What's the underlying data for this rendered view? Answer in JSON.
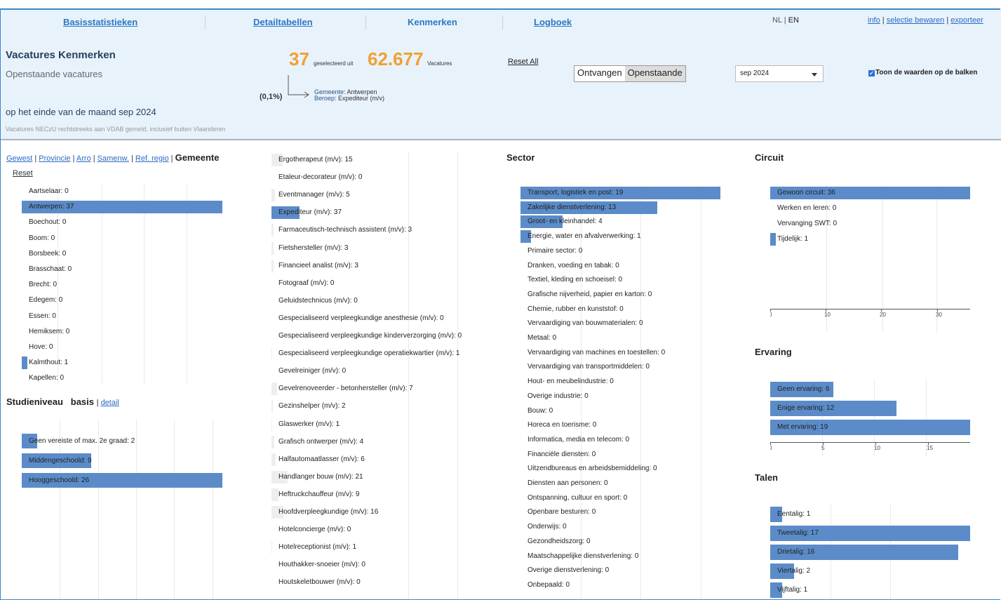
{
  "nav": {
    "items": [
      {
        "label": "Basisstatistieken"
      },
      {
        "label": "Detailtabellen"
      },
      {
        "label": "Kenmerken"
      },
      {
        "label": "Logboek"
      }
    ],
    "lang_nl": "NL",
    "lang_sep": " | ",
    "lang_en": "EN",
    "info": "info",
    "bewaren": "selectie bewaren",
    "export": "exporteer",
    "sep": " | "
  },
  "header": {
    "title": "Vacatures Kenmerken",
    "subtitle": "Openstaande vacatures",
    "period": "op het einde van de maand sep 2024",
    "note": "Vacatures NECzU rechtstreeks aan VDAB gemeld, inclusief buiten Vlaanderen",
    "selected": "37",
    "selected_label": "geselecteerd uit",
    "total": "62.677",
    "total_label": "Vacatures",
    "pct": "(0,1%)",
    "filter1_key": "Gemeente",
    "filter1_val": ": Antwerpen",
    "filter2_key": "Beroep",
    "filter2_val": ": Expediteur (m/v)",
    "reset_all": "Reset All",
    "toggle": [
      "Ontvangen",
      "Openstaande"
    ],
    "month": "sep 2024",
    "show_values": "Toon de waarden op de balken"
  },
  "geo": {
    "tabs": [
      "Gewest",
      "Provincie",
      "Arro",
      "Samenw.",
      "Ref. regio"
    ],
    "active": "Gemeente",
    "tab_sep": " | ",
    "reset": "Reset",
    "max": 37,
    "rows": [
      {
        "label": "Aartselaar: 0",
        "value": 0
      },
      {
        "label": "Antwerpen: 37",
        "value": 37
      },
      {
        "label": "Boechout: 0",
        "value": 0
      },
      {
        "label": "Boom: 0",
        "value": 0
      },
      {
        "label": "Borsbeek: 0",
        "value": 0
      },
      {
        "label": "Brasschaat: 0",
        "value": 0
      },
      {
        "label": "Brecht: 0",
        "value": 0
      },
      {
        "label": "Edegem: 0",
        "value": 0
      },
      {
        "label": "Essen: 0",
        "value": 0
      },
      {
        "label": "Hemiksem: 0",
        "value": 0
      },
      {
        "label": "Hove: 0",
        "value": 0
      },
      {
        "label": "Kalmthout: 1",
        "value": 1
      },
      {
        "label": "Kapellen: 0",
        "value": 0
      }
    ]
  },
  "studie": {
    "title": "Studieniveau",
    "basis": "basis",
    "sep": " | ",
    "detail": "detail",
    "max": 26,
    "rows": [
      {
        "label": "Geen vereiste of max. 2e graad: 2",
        "value": 2
      },
      {
        "label": "Middengeschoold: 9",
        "value": 9
      },
      {
        "label": "Hooggeschoold: 26",
        "value": 26
      }
    ]
  },
  "beroep": {
    "max": 37,
    "rows": [
      {
        "label": "Ergotherapeut (m/v): 15",
        "value": 15
      },
      {
        "label": "Etaleur-decorateur (m/v): 0",
        "value": 0
      },
      {
        "label": "Eventmanager (m/v): 5",
        "value": 5
      },
      {
        "label": "Expediteur (m/v): 37",
        "value": 37,
        "sel": true
      },
      {
        "label": "Farmaceutisch-technisch assistent (m/v): 3",
        "value": 3
      },
      {
        "label": "Fietshersteller (m/v): 3",
        "value": 3
      },
      {
        "label": "Financieel analist (m/v): 3",
        "value": 3
      },
      {
        "label": "Fotograaf (m/v): 0",
        "value": 0
      },
      {
        "label": "Geluidstechnicus (m/v): 0",
        "value": 0
      },
      {
        "label": "Gespecialiseerd verpleegkundige anesthesie (m/v): 0",
        "value": 0
      },
      {
        "label": "Gespecialiseerd verpleegkundige kinderverzorging (m/v): 0",
        "value": 0
      },
      {
        "label": "Gespecialiseerd verpleegkundige operatiekwartier (m/v): 1",
        "value": 1
      },
      {
        "label": "Gevelreiniger (m/v): 0",
        "value": 0
      },
      {
        "label": "Gevelrenoveerder - betonhersteller (m/v): 7",
        "value": 7
      },
      {
        "label": "Gezinshelper (m/v): 2",
        "value": 2
      },
      {
        "label": "Glaswerker (m/v): 1",
        "value": 1
      },
      {
        "label": "Grafisch ontwerper (m/v): 4",
        "value": 4
      },
      {
        "label": "Halfautomaatlasser (m/v): 6",
        "value": 6
      },
      {
        "label": "Handlanger bouw (m/v): 21",
        "value": 21
      },
      {
        "label": "Heftruckchauffeur (m/v): 9",
        "value": 9
      },
      {
        "label": "Hoofdverpleegkundige (m/v): 16",
        "value": 16
      },
      {
        "label": "Hotelconcierge (m/v): 0",
        "value": 0
      },
      {
        "label": "Hotelreceptionist (m/v): 1",
        "value": 1
      },
      {
        "label": "Houthakker-snoeier (m/v): 0",
        "value": 0
      },
      {
        "label": "Houtskeletbouwer (m/v): 0",
        "value": 0
      }
    ]
  },
  "sector": {
    "title": "Sector",
    "max": 19,
    "rows": [
      {
        "label": "Transport, logistiek en post: 19",
        "value": 19
      },
      {
        "label": "Zakelijke dienstverlening: 13",
        "value": 13
      },
      {
        "label": "Groot- en kleinhandel: 4",
        "value": 4
      },
      {
        "label": "Energie, water en afvalverwerking: 1",
        "value": 1
      },
      {
        "label": "Primaire sector: 0",
        "value": 0
      },
      {
        "label": "Dranken, voeding en tabak: 0",
        "value": 0
      },
      {
        "label": "Textiel, kleding en schoeisel: 0",
        "value": 0
      },
      {
        "label": "Grafische nijverheid, papier en karton: 0",
        "value": 0
      },
      {
        "label": "Chemie, rubber en kunststof: 0",
        "value": 0
      },
      {
        "label": "Vervaardiging van bouwmaterialen: 0",
        "value": 0
      },
      {
        "label": "Metaal: 0",
        "value": 0
      },
      {
        "label": "Vervaardiging van machines en toestellen: 0",
        "value": 0
      },
      {
        "label": "Vervaardiging van transportmiddelen: 0",
        "value": 0
      },
      {
        "label": "Hout- en meubelindustrie: 0",
        "value": 0
      },
      {
        "label": "Overige industrie: 0",
        "value": 0
      },
      {
        "label": "Bouw: 0",
        "value": 0
      },
      {
        "label": "Horeca en toerisme: 0",
        "value": 0
      },
      {
        "label": "Informatica, media en telecom: 0",
        "value": 0
      },
      {
        "label": "Financiële diensten: 0",
        "value": 0
      },
      {
        "label": "Uitzendbureaus en arbeidsbemiddeling: 0",
        "value": 0
      },
      {
        "label": "Diensten aan personen: 0",
        "value": 0
      },
      {
        "label": "Ontspanning, cultuur en sport: 0",
        "value": 0
      },
      {
        "label": "Openbare besturen: 0",
        "value": 0
      },
      {
        "label": "Onderwijs: 0",
        "value": 0
      },
      {
        "label": "Gezondheidszorg: 0",
        "value": 0
      },
      {
        "label": "Maatschappelijke dienstverlening: 0",
        "value": 0
      },
      {
        "label": "Overige dienstverlening: 0",
        "value": 0
      },
      {
        "label": "Onbepaald: 0",
        "value": 0
      }
    ]
  },
  "circuit": {
    "title": "Circuit",
    "max": 36,
    "ticks": [
      "0",
      "10",
      "20",
      "30"
    ],
    "rows": [
      {
        "label": "Gewoon circuit: 36",
        "value": 36
      },
      {
        "label": "Werken en leren: 0",
        "value": 0
      },
      {
        "label": "Vervanging SWT: 0",
        "value": 0
      },
      {
        "label": "Tijdelijk: 1",
        "value": 1
      }
    ]
  },
  "ervaring": {
    "title": "Ervaring",
    "max": 19,
    "ticks": [
      "0",
      "5",
      "10",
      "15"
    ],
    "rows": [
      {
        "label": "Geen ervaring: 6",
        "value": 6
      },
      {
        "label": "Enige ervaring: 12",
        "value": 12
      },
      {
        "label": "Met ervaring: 19",
        "value": 19
      }
    ]
  },
  "talen": {
    "title": "Talen",
    "max": 17,
    "rows": [
      {
        "label": "Eentalig: 1",
        "value": 1
      },
      {
        "label": "Tweetalig: 17",
        "value": 17
      },
      {
        "label": "Drietalig: 16",
        "value": 16
      },
      {
        "label": "Viertalig: 2",
        "value": 2
      },
      {
        "label": "Vijftalig: 1",
        "value": 1
      }
    ]
  },
  "colors": {
    "bar": "#5b8cc9",
    "accent": "#f0a032",
    "nav": "#2b78c4"
  }
}
